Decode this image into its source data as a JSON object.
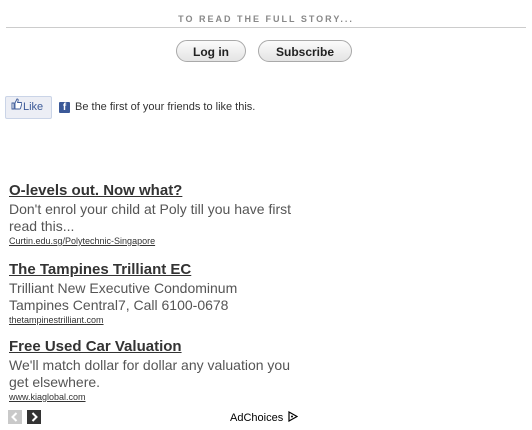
{
  "header": {
    "read_more": "TO READ THE FULL STORY..."
  },
  "buttons": {
    "login": "Log in",
    "subscribe": "Subscribe"
  },
  "facebook": {
    "like_label": "Like",
    "social_text": "Be the first of your friends to like this.",
    "icon_letter": "f",
    "brand_color": "#3b5998"
  },
  "ads": [
    {
      "title": "O-levels out. Now what?",
      "desc_lines": [
        "Don't enrol your child at Poly till you have first",
        "read this..."
      ],
      "url": "Curtin.edu.sg/Polytechnic-Singapore"
    },
    {
      "title": "The Tampines Trilliant EC",
      "desc_lines": [
        "Trilliant New Executive Condominum",
        "Tampines Central7, Call 6100-0678"
      ],
      "url": "thetampinestrilliant.com"
    },
    {
      "title": "Free Used Car Valuation",
      "desc_lines": [
        "We'll match dollar for dollar any valuation you",
        "get elsewhere."
      ],
      "url": "www.kiaglobal.com"
    }
  ],
  "footer": {
    "adchoices": "AdChoices",
    "prev_icon": "chevron-left-icon",
    "next_icon": "chevron-right-icon"
  }
}
